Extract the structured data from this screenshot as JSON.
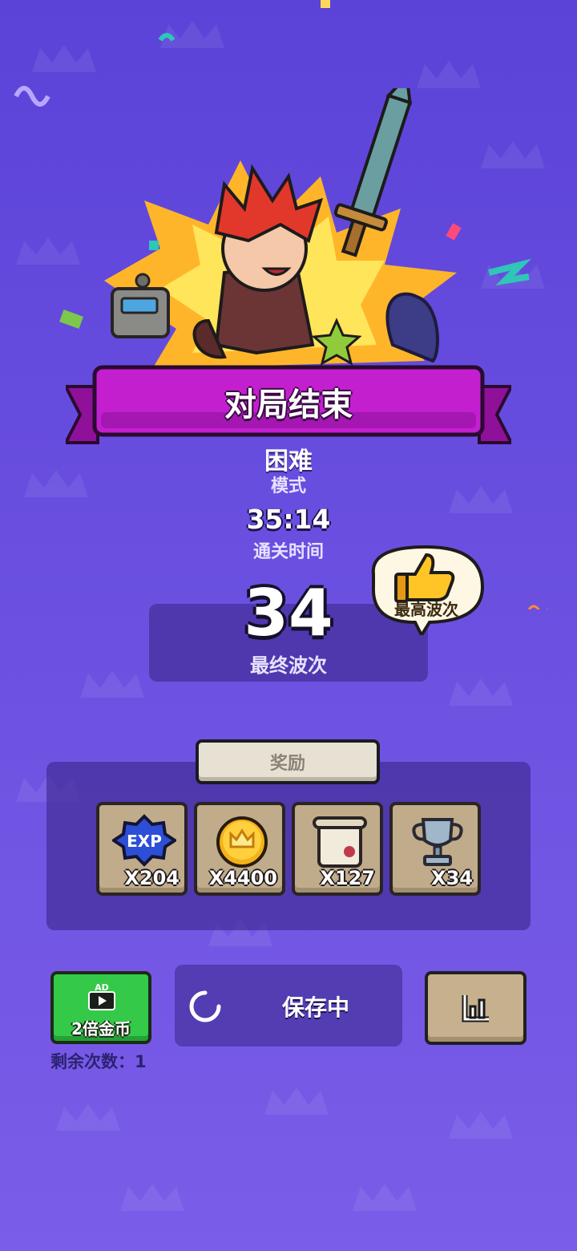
{
  "header": {
    "title": "对局结束"
  },
  "mode": {
    "value": "困难",
    "label": "模式"
  },
  "clear_time": {
    "value": "35:14",
    "label": "通关时间"
  },
  "final_wave": {
    "value": "34",
    "label": "最终波次",
    "best_badge": "最高波次"
  },
  "rewards": {
    "tab_label": "奖励",
    "items": [
      {
        "icon": "exp-badge-icon",
        "count": "X204"
      },
      {
        "icon": "gold-coin-icon",
        "count": "X4400"
      },
      {
        "icon": "scroll-icon",
        "count": "X127"
      },
      {
        "icon": "trophy-icon",
        "count": "X34"
      }
    ]
  },
  "actions": {
    "ad_badge": "AD",
    "ad_button_label": "2倍金币",
    "remaining_text": "剩余次数：1",
    "save_label": "保存中",
    "stats_icon": "stats-chart-icon"
  },
  "colors": {
    "background": "#5b43d8",
    "ribbon": "#c31fcf",
    "ad_button": "#35c94a",
    "card": "#c0ac8b"
  }
}
